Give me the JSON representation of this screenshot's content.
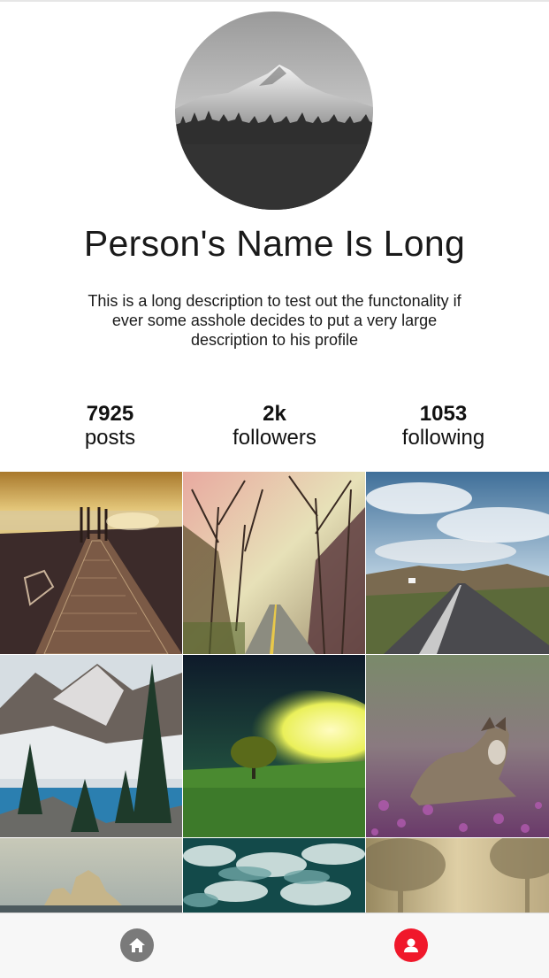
{
  "profile": {
    "name": "Person's Name Is Long",
    "bio": "This is a long description to test out the functonality if ever some asshole decides to put a very large description to his profile"
  },
  "stats": [
    {
      "value": "7925",
      "label": "posts"
    },
    {
      "value": "2k",
      "label": "followers"
    },
    {
      "value": "1053",
      "label": "following"
    }
  ],
  "grid": {
    "photos": [
      {
        "subject": "pier-at-sunset"
      },
      {
        "subject": "forest-road"
      },
      {
        "subject": "highway-under-clouds"
      },
      {
        "subject": "mountain-lake-pines"
      },
      {
        "subject": "tree-in-green-field"
      },
      {
        "subject": "wolf-in-flowers"
      },
      {
        "subject": "rock-in-sea"
      },
      {
        "subject": "stormy-clouds"
      },
      {
        "subject": "foggy-trees"
      }
    ]
  },
  "tabbar": {
    "items": [
      {
        "icon": "home-icon",
        "color": "#7a7a7a",
        "active": false
      },
      {
        "icon": "profile-icon",
        "color": "#f0182b",
        "active": true
      }
    ]
  },
  "colors": {
    "accent": "#f0182b",
    "inactive": "#7a7a7a",
    "tabbar_bg": "#f7f7f7"
  }
}
